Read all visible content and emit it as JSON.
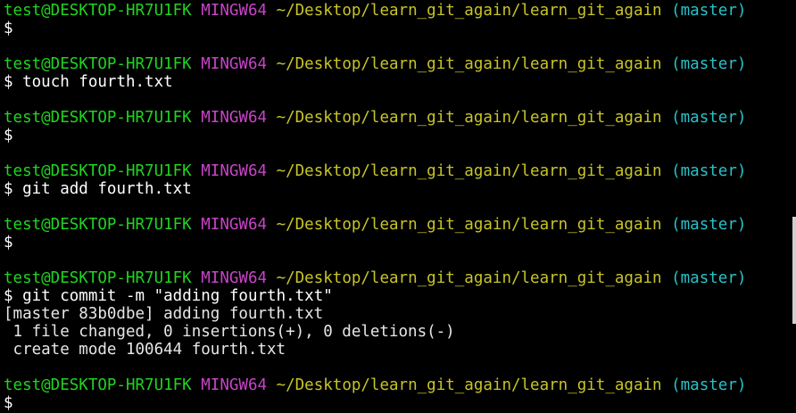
{
  "prompt": {
    "user_host": "test@DESKTOP-HR7U1FK",
    "system": "MINGW64",
    "path": "~/Desktop/learn_git_again/learn_git_again",
    "branch": "(master)",
    "symbol": "$"
  },
  "blocks": [
    {
      "command": "",
      "output": []
    },
    {
      "command": "touch fourth.txt",
      "output": []
    },
    {
      "command": "",
      "output": []
    },
    {
      "command": "git add fourth.txt",
      "output": []
    },
    {
      "command": "",
      "output": []
    },
    {
      "command": "git commit -m \"adding fourth.txt\"",
      "output": [
        "[master 83b0dbe] adding fourth.txt",
        " 1 file changed, 0 insertions(+), 0 deletions(-)",
        " create mode 100644 fourth.txt"
      ]
    },
    {
      "command": "",
      "output": []
    }
  ],
  "colors": {
    "background": "#000000",
    "user_host": "#20d420",
    "system": "#c844c8",
    "path": "#c8c428",
    "branch": "#2ac0c8",
    "text": "#ffffff"
  }
}
